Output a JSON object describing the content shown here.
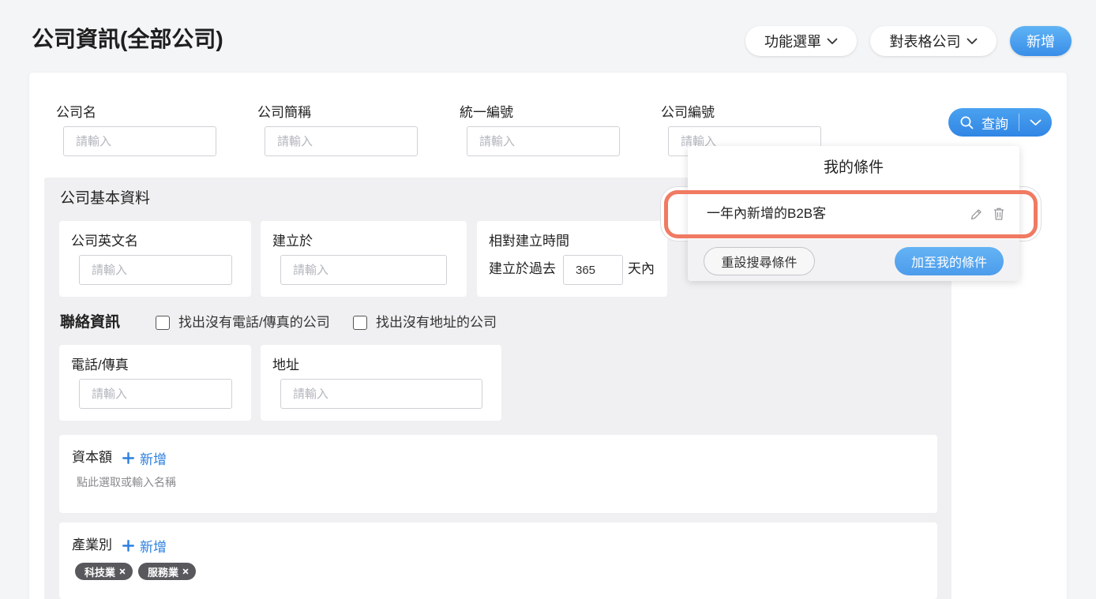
{
  "page": {
    "title": "公司資訊(全部公司)"
  },
  "header": {
    "function_menu_label": "功能選單",
    "compare_table_label": "對表格公司",
    "add_label": "新增"
  },
  "search": {
    "fields": [
      {
        "label": "公司名",
        "placeholder": "請輸入"
      },
      {
        "label": "公司簡稱",
        "placeholder": "請輸入"
      },
      {
        "label": "統一編號",
        "placeholder": "請輸入"
      },
      {
        "label": "公司編號",
        "placeholder": "請輸入"
      }
    ],
    "query_label": "查詢"
  },
  "basic_info": {
    "heading": "公司基本資料",
    "english_name": {
      "label": "公司英文名",
      "placeholder": "請輸入"
    },
    "established": {
      "label": "建立於",
      "placeholder": "請輸入"
    },
    "relative_time": {
      "label": "相對建立時間",
      "prefix": "建立於過去",
      "value": "365",
      "suffix": "天內"
    }
  },
  "contact": {
    "heading": "聯絡資訊",
    "filters": [
      {
        "label": "找出沒有電話/傳真的公司",
        "checked": false
      },
      {
        "label": "找出沒有地址的公司",
        "checked": false
      }
    ],
    "phone": {
      "label": "電話/傳真",
      "placeholder": "請輸入"
    },
    "address": {
      "label": "地址",
      "placeholder": "請輸入"
    }
  },
  "capital": {
    "label": "資本額",
    "add_label": "新增",
    "hint": "點此選取或輸入名稱"
  },
  "industry": {
    "label": "產業別",
    "add_label": "新增",
    "tags": [
      "科技業",
      "服務業"
    ]
  },
  "saved_conditions": {
    "title": "我的條件",
    "items": [
      {
        "name": "一年內新增的B2B客"
      }
    ],
    "reset_label": "重設搜尋條件",
    "save_label": "加至我的條件"
  },
  "icons": [
    "chevron-down-icon",
    "search-icon",
    "plus-icon",
    "pencil-icon",
    "trash-icon",
    "close-icon"
  ],
  "colors": {
    "page_background": "#f4f5f7",
    "panel_background": "#f0f0f2",
    "primary": "#3a8ee6",
    "link": "#2b7fe0",
    "tag": "#59595d",
    "highlight": "#f07a62"
  }
}
